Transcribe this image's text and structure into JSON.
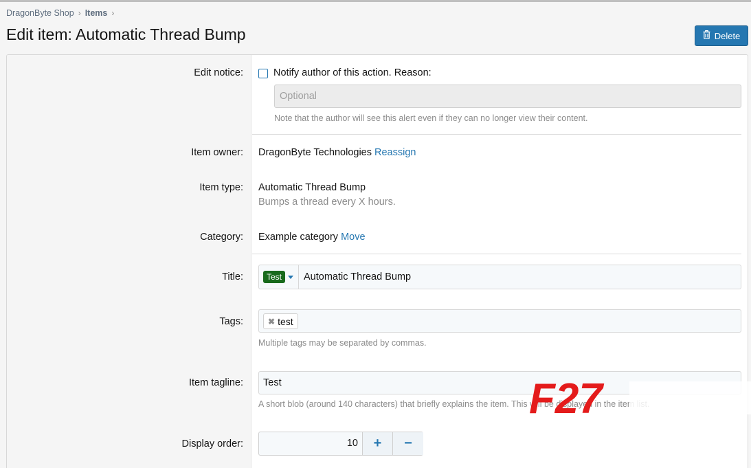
{
  "breadcrumb": {
    "items": [
      "DragonByte Shop",
      "Items"
    ],
    "separator": "›"
  },
  "page": {
    "title": "Edit item: Automatic Thread Bump"
  },
  "header": {
    "delete_label": "Delete",
    "delete_icon": "trash-icon"
  },
  "form": {
    "edit_notice": {
      "label": "Edit notice:",
      "checkbox_label": "Notify author of this action. Reason:",
      "checked": false,
      "reason_placeholder": "Optional",
      "hint": "Note that the author will see this alert even if they can no longer view their content."
    },
    "item_owner": {
      "label": "Item owner:",
      "value": "DragonByte Technologies",
      "action": "Reassign"
    },
    "item_type": {
      "label": "Item type:",
      "value": "Automatic Thread Bump",
      "description": "Bumps a thread every X hours."
    },
    "category": {
      "label": "Category:",
      "value": "Example category",
      "action": "Move"
    },
    "title": {
      "label": "Title:",
      "prefix": "Test",
      "value": "Automatic Thread Bump"
    },
    "tags": {
      "label": "Tags:",
      "tag_items": [
        "test"
      ],
      "hint": "Multiple tags may be separated by commas."
    },
    "tagline": {
      "label": "Item tagline:",
      "value": "Test",
      "hint": "A short blob (around 140 characters) that briefly explains the item. This will be displayed in the item list."
    },
    "display_order": {
      "label": "Display order:",
      "value": "10",
      "plus": "+",
      "minus": "−"
    }
  },
  "watermark": {
    "text": "F27"
  },
  "colors": {
    "accent": "#2577b1",
    "prefix_bg": "#186a1c",
    "watermark": "#e41b1b"
  }
}
